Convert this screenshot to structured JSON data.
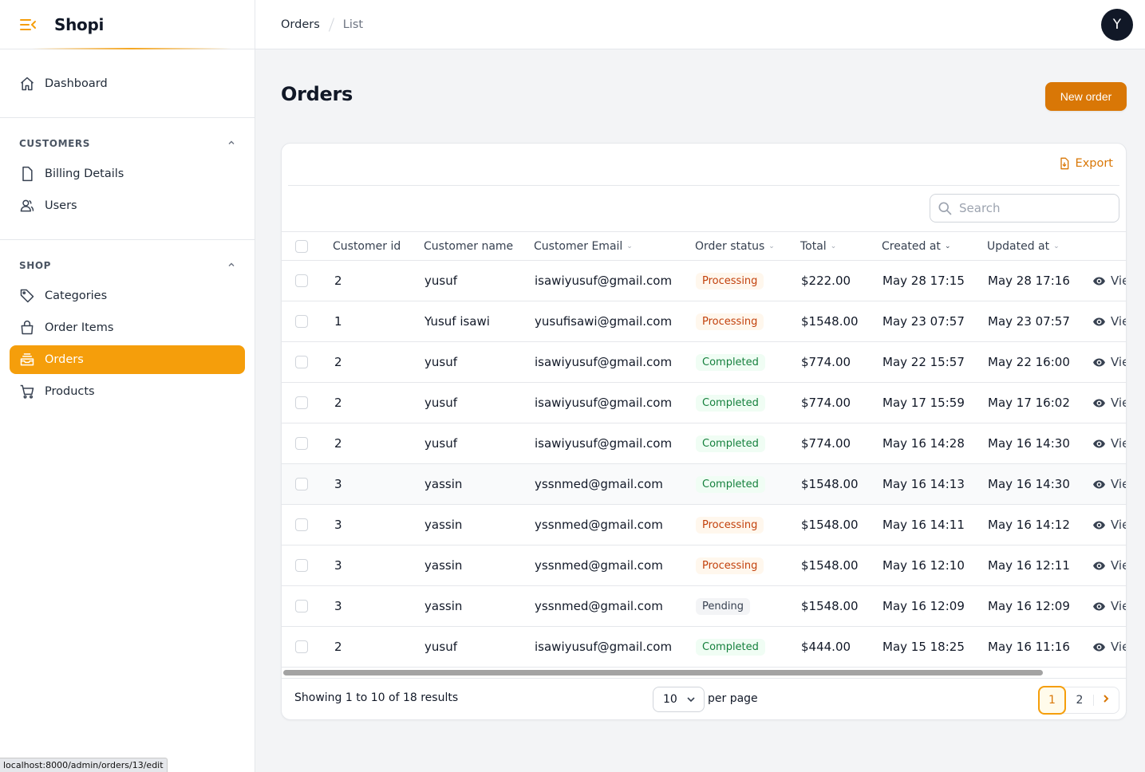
{
  "app": {
    "name": "Shopi"
  },
  "sidebar": {
    "dashboard": "Dashboard",
    "groups": [
      {
        "title": "CUSTOMERS",
        "items": [
          "Billing Details",
          "Users"
        ]
      },
      {
        "title": "SHOP",
        "items": [
          "Categories",
          "Order Items",
          "Orders",
          "Products"
        ]
      }
    ],
    "active": "Orders"
  },
  "breadcrumb": {
    "first": "Orders",
    "second": "List"
  },
  "user": {
    "initial": "Y"
  },
  "page": {
    "title": "Orders",
    "new_button": "New order"
  },
  "toolbar": {
    "export_label": "Export",
    "search_placeholder": "Search"
  },
  "table": {
    "headers": [
      "Customer id",
      "Customer name",
      "Customer Email",
      "Order status",
      "Total",
      "Created at",
      "Updated at"
    ],
    "view_label": "View",
    "rows": [
      [
        "2",
        "yusuf",
        "isawiyusuf@gmail.com",
        "Processing",
        "$222.00",
        "May 28 17:15",
        "May 28 17:16"
      ],
      [
        "1",
        "Yusuf isawi",
        "yusufisawi@gmail.com",
        "Processing",
        "$1548.00",
        "May 23 07:57",
        "May 23 07:57"
      ],
      [
        "2",
        "yusuf",
        "isawiyusuf@gmail.com",
        "Completed",
        "$774.00",
        "May 22 15:57",
        "May 22 16:00"
      ],
      [
        "2",
        "yusuf",
        "isawiyusuf@gmail.com",
        "Completed",
        "$774.00",
        "May 17 15:59",
        "May 17 16:02"
      ],
      [
        "2",
        "yusuf",
        "isawiyusuf@gmail.com",
        "Completed",
        "$774.00",
        "May 16 14:28",
        "May 16 14:30"
      ],
      [
        "3",
        "yassin",
        "yssnmed@gmail.com",
        "Completed",
        "$1548.00",
        "May 16 14:13",
        "May 16 14:30"
      ],
      [
        "3",
        "yassin",
        "yssnmed@gmail.com",
        "Processing",
        "$1548.00",
        "May 16 14:11",
        "May 16 14:12"
      ],
      [
        "3",
        "yassin",
        "yssnmed@gmail.com",
        "Processing",
        "$1548.00",
        "May 16 12:10",
        "May 16 12:11"
      ],
      [
        "3",
        "yassin",
        "yssnmed@gmail.com",
        "Pending",
        "$1548.00",
        "May 16 12:09",
        "May 16 12:09"
      ],
      [
        "2",
        "yusuf",
        "isawiyusuf@gmail.com",
        "Completed",
        "$444.00",
        "May 15 18:25",
        "May 16 11:16"
      ]
    ]
  },
  "footer": {
    "showing": "Showing 1 to 10 of 18 results",
    "per_page_value": "10",
    "per_page_label": "per page",
    "pages": [
      "1",
      "2"
    ],
    "current_page": "1"
  },
  "status_bar": {
    "url": "localhost:8000/admin/orders/13/edit"
  },
  "colors": {
    "accent": "#f59e0b",
    "accent_dark": "#d97706"
  }
}
